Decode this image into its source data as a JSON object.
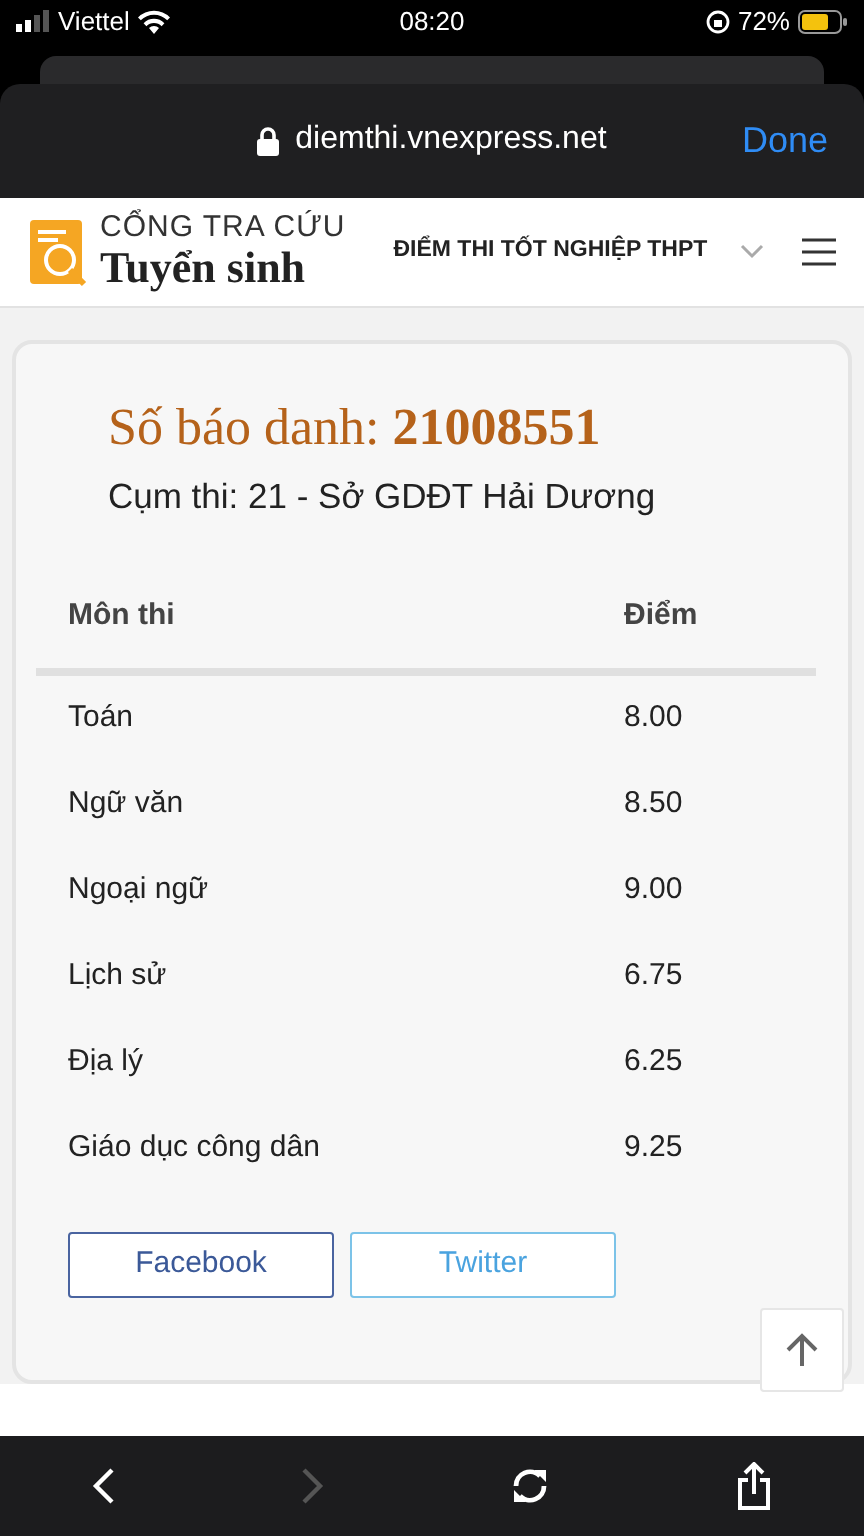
{
  "status_bar": {
    "carrier": "Viettel",
    "time": "08:20",
    "battery": "72%"
  },
  "browser": {
    "url": "diemthi.vnexpress.net",
    "done": "Done"
  },
  "site_header": {
    "logo_top": "CỔNG TRA CỨU",
    "logo_bottom": "Tuyển sinh",
    "section": "ĐIỂM THI TỐT NGHIỆP THPT"
  },
  "result": {
    "title": "Số báo danh: **21008551**",
    "cluster": "Cụm thi: 21 - Sở GDĐT Hải Dương",
    "columns": [
      "Môn thi",
      "Điểm"
    ],
    "rows": [
      {
        "subject": "Toán",
        "score": "8.00"
      },
      {
        "subject": "Ngữ văn",
        "score": "8.50"
      },
      {
        "subject": "Ngoại ngữ",
        "score": "9.00"
      },
      {
        "subject": "Lịch sử",
        "score": "6.75"
      },
      {
        "subject": "Địa lý",
        "score": "6.25"
      },
      {
        "subject": "Giáo dục công dân",
        "score": "9.25"
      }
    ],
    "share_buttons": [
      {
        "label": "Facebook",
        "kind": "facebook"
      },
      {
        "label": "Twitter",
        "kind": "twitter"
      }
    ]
  },
  "toolbar": {
    "back_disabled": false,
    "forward_disabled": true
  }
}
